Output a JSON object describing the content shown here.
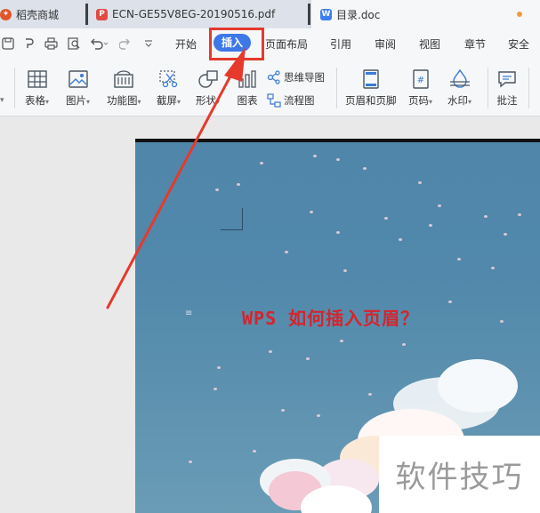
{
  "tabs": {
    "store": {
      "label": "稻壳商城",
      "icon": "daoke-logo-icon"
    },
    "pdf": {
      "label": "ECN-GE55V8EG-20190516.pdf",
      "icon": "pdf-file-icon"
    },
    "doc": {
      "label": "目录.doc",
      "icon": "word-doc-icon"
    }
  },
  "menu": {
    "items": [
      "开始",
      "插入",
      "页面布局",
      "引用",
      "审阅",
      "视图",
      "章节",
      "安全"
    ],
    "active": "插入"
  },
  "ribbon": {
    "table": "表格",
    "picture": "图片",
    "function_chart": "功能图",
    "screenshot": "截屏",
    "shape": "形状",
    "chart": "图表",
    "mindmap": "思维导图",
    "flowchart": "流程图",
    "header_footer": "页眉和页脚",
    "page_number": "页码",
    "watermark": "水印",
    "comment": "批注",
    "dropdown_glyph": "▾"
  },
  "document": {
    "heading": "WPS 如何插入页眉？"
  },
  "overlay": {
    "watermark_text": "软件技巧",
    "annotation_color": "#e53a2c"
  },
  "colors": {
    "accent": "#3d78e8",
    "heading_red": "#d8232a"
  }
}
